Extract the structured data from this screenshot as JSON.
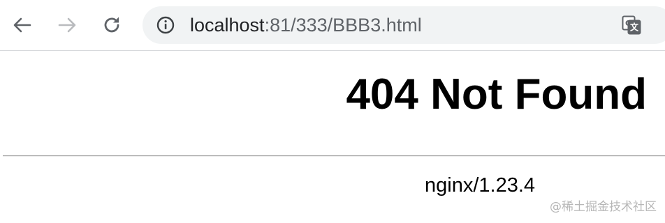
{
  "browser": {
    "url_host": "localhost",
    "url_rest": ":81/333/BBB3.html"
  },
  "page": {
    "heading": "404 Not Found",
    "server_signature": "nginx/1.23.4"
  },
  "watermark": "@稀土掘金技术社区",
  "colors": {
    "toolbar_bg": "#ffffff",
    "omnibox_bg": "#f1f3f4",
    "icon_gray": "#5f6368",
    "icon_disabled": "#b9bbbe"
  }
}
